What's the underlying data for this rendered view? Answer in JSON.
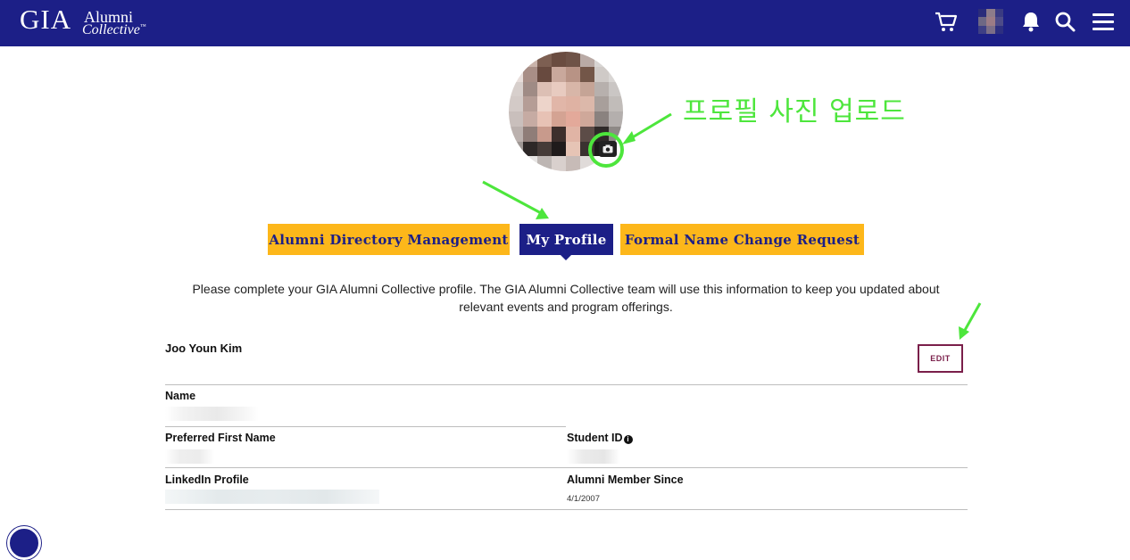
{
  "header": {
    "logo_main": "GIA",
    "logo_line1": "Alumni",
    "logo_line2": "Collective",
    "logo_tm": "™",
    "icons": [
      "cart-icon",
      "avatar",
      "bell-icon",
      "search-icon",
      "menu-icon"
    ],
    "bg_color": "#1c1f87"
  },
  "annotation": {
    "label": "프로필 사진 업로드",
    "color": "#4de63c"
  },
  "tabs": [
    {
      "label": "Alumni Directory Management",
      "active": false
    },
    {
      "label": "My Profile",
      "active": true
    },
    {
      "label": "Formal Name Change Request",
      "active": false
    }
  ],
  "intro_text": "Please complete your GIA Alumni Collective profile. The GIA Alumni Collective team will use this information to keep you updated about relevant events and program offerings.",
  "profile": {
    "full_name": "Joo Youn Kim",
    "edit_label": "EDIT",
    "fields": {
      "name_label": "Name",
      "preferred_first_name_label": "Preferred First Name",
      "student_id_label": "Student ID",
      "linkedin_label": "LinkedIn Profile",
      "alumni_since_label": "Alumni Member Since",
      "alumni_since_value": "4/1/2007"
    }
  },
  "colors": {
    "brand_navy": "#1c1f87",
    "tab_gold": "#fdb71a",
    "edit_maroon": "#7a1f4a"
  }
}
